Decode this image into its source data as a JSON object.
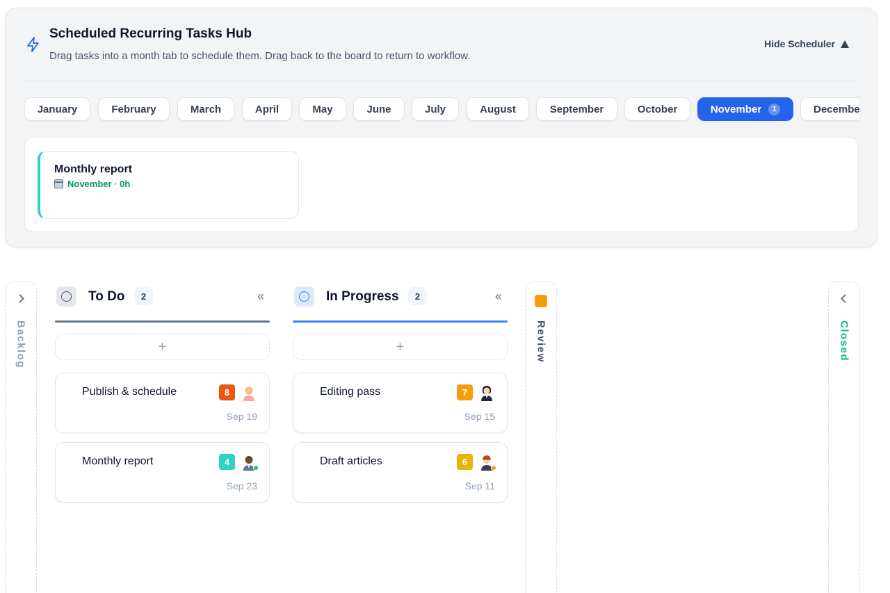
{
  "scheduler": {
    "title": "Scheduled Recurring Tasks Hub",
    "subtitle": "Drag tasks into a month tab to schedule them. Drag back to the board to return to workflow.",
    "hide_label": "Hide Scheduler",
    "active_month": "November",
    "months": [
      {
        "label": "January"
      },
      {
        "label": "February"
      },
      {
        "label": "March"
      },
      {
        "label": "April"
      },
      {
        "label": "May"
      },
      {
        "label": "June"
      },
      {
        "label": "July"
      },
      {
        "label": "August"
      },
      {
        "label": "September"
      },
      {
        "label": "October"
      },
      {
        "label": "November",
        "count": "1"
      },
      {
        "label": "December"
      }
    ],
    "scheduled_tasks": [
      {
        "name": "Monthly report",
        "meta": "November · 0h",
        "accent": "#2dd4bf"
      }
    ]
  },
  "board": {
    "collapsed": {
      "backlog": {
        "label": "Backlog",
        "color": "#94a3b8"
      },
      "review": {
        "label": "Review",
        "color": "#475569",
        "accent": "#f59e0b"
      },
      "closed": {
        "label": "Closed",
        "color": "#10b981"
      }
    },
    "columns": [
      {
        "title": "To Do",
        "count": "2",
        "bar_color": "#64748b",
        "icon_bg": "#e5e7eb",
        "icon_ring": "#475569",
        "tasks": [
          {
            "name": "Publish & schedule",
            "priority": "8",
            "priority_color": "#ea580c",
            "due": "Sep 19",
            "avatar": "avatar-bald-man"
          },
          {
            "name": "Monthly report",
            "priority": "4",
            "priority_color": "#2dd4bf",
            "due": "Sep 23",
            "avatar": "avatar-dark-man",
            "status_color": "#22c55e"
          }
        ]
      },
      {
        "title": "In Progress",
        "count": "2",
        "bar_color": "#3b82f6",
        "icon_bg": "#dbeafe",
        "icon_ring": "#3b82f6",
        "tasks": [
          {
            "name": "Editing pass",
            "priority": "7",
            "priority_color": "#f59e0b",
            "due": "Sep 15",
            "avatar": "avatar-woman"
          },
          {
            "name": "Draft articles",
            "priority": "6",
            "priority_color": "#eab308",
            "due": "Sep 11",
            "avatar": "avatar-cap-man",
            "status_color": "#f59e0b"
          }
        ]
      }
    ]
  }
}
